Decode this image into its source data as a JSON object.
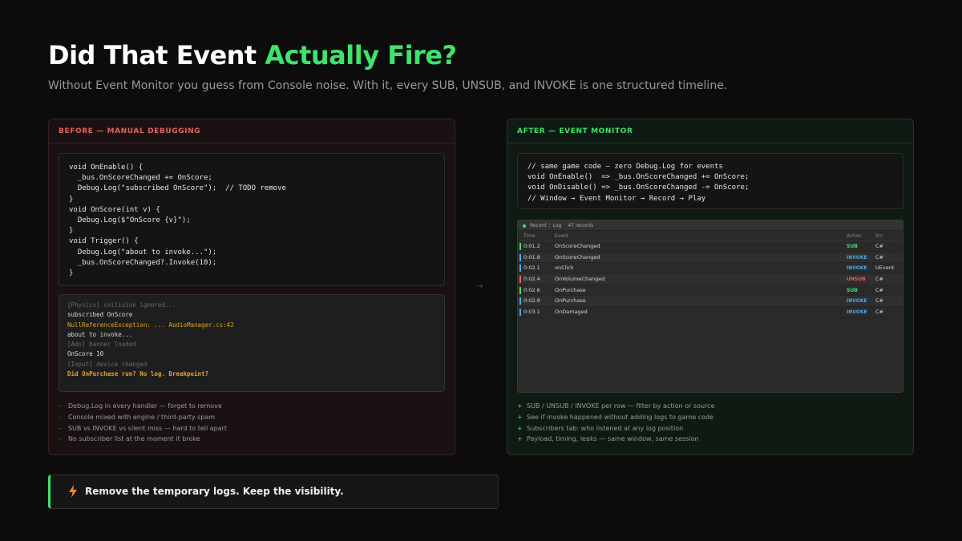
{
  "header": {
    "title_prefix": "Did That Event ",
    "title_accent": "Actually Fire?",
    "subtitle": "Without Event Monitor you guess from Console noise. With it, every SUB, UNSUB, and INVOKE is one structured timeline."
  },
  "before": {
    "heading": "BEFORE — MANUAL DEBUGGING",
    "code": [
      "void OnEnable() {",
      "  _bus.OnScoreChanged += OnScore;",
      "  Debug.Log(\"subscribed OnScore\");  // TODO remove",
      "}",
      "void OnScore(int v) {",
      "  Debug.Log($\"OnScore {v}\");",
      "}",
      "void Trigger() {",
      "  Debug.Log(\"about to invoke...\");",
      "  _bus.OnScoreChanged?.Invoke(10);",
      "}"
    ],
    "console": [
      {
        "text": "[Physics] collision ignored...",
        "kind": "muted"
      },
      {
        "text": "subscribed OnScore",
        "kind": "normal"
      },
      {
        "text": "NullReferenceException: ... AudioManager.cs:42",
        "kind": "warn"
      },
      {
        "text": "about to invoke...",
        "kind": "normal"
      },
      {
        "text": "[Ads] banner loaded",
        "kind": "muted"
      },
      {
        "text": "OnScore 10",
        "kind": "normal"
      },
      {
        "text": "[Input] device changed",
        "kind": "muted"
      },
      {
        "text": "Did OnPurchase run? No log. Breakpoint?",
        "kind": "ques"
      }
    ],
    "bullets": [
      "Debug.Log in every handler — forget to remove",
      "Console mixed with engine / third-party spam",
      "SUB vs INVOKE vs silent miss — hard to tell apart",
      "No subscriber list at the moment it broke"
    ],
    "bullet_marker": "–"
  },
  "arrow": "→",
  "after": {
    "heading": "AFTER — EVENT MONITOR",
    "code": [
      "// same game code – zero Debug.Log for events",
      "void OnEnable()  => _bus.OnScoreChanged += OnScore;",
      "void OnDisable() => _bus.OnScoreChanged -= OnScore;",
      "// Window → Event Monitor → Record → Play"
    ],
    "monitor": {
      "toolbar": {
        "record": "Record",
        "log": "Log",
        "count": "47 records"
      },
      "columns": {
        "time": "Time",
        "event": "Event",
        "action": "Action",
        "src": "Src"
      },
      "rows": [
        {
          "time": "0:01.2",
          "event": "OnScoreChanged",
          "action": "SUB",
          "src": "C#"
        },
        {
          "time": "0:01.8",
          "event": "OnScoreChanged",
          "action": "INVOKE",
          "src": "C#"
        },
        {
          "time": "0:02.1",
          "event": "onClick",
          "action": "INVOKE",
          "src": "UEvent"
        },
        {
          "time": "0:02.4",
          "event": "OnVolumeChanged",
          "action": "UNSUB",
          "src": "C#"
        },
        {
          "time": "0:02.6",
          "event": "OnPurchase",
          "action": "SUB",
          "src": "C#"
        },
        {
          "time": "0:02.9",
          "event": "OnPurchase",
          "action": "INVOKE",
          "src": "C#"
        },
        {
          "time": "0:03.1",
          "event": "OnDamaged",
          "action": "INVOKE",
          "src": "C#"
        }
      ],
      "action_colors": {
        "SUB": "#3ee36b",
        "INVOKE": "#4aa8e8",
        "UNSUB": "#e0645f"
      }
    },
    "bullets": [
      "SUB / UNSUB / INVOKE per row — filter by action or source",
      "See if invoke happened without adding logs to game code",
      "Subscribers tab: who listened at any log position",
      "Payload, timing, leaks — same window, same session"
    ],
    "bullet_marker": "+"
  },
  "callout": {
    "icon": "lightning-bolt-icon",
    "text": "Remove the temporary logs. Keep the visibility."
  },
  "colors": {
    "accent": "#3ee36b",
    "before_accent": "#e0645f",
    "warn": "#e0a526",
    "invoke": "#4aa8e8"
  }
}
